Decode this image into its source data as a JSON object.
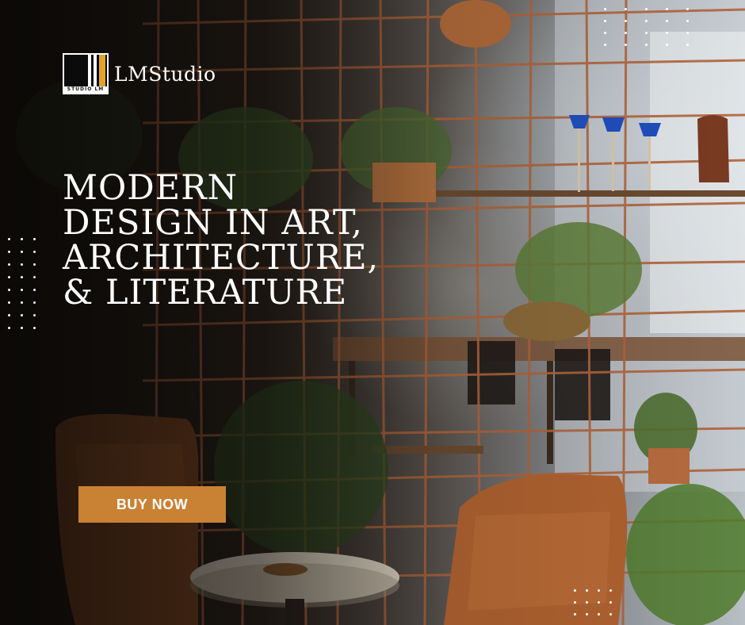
{
  "brand": {
    "name": "LMStudio",
    "mark_text": "STUDIO LM",
    "accent": "#e0a42b"
  },
  "headline": {
    "lines": [
      "MODERN",
      "DESIGN IN ART,",
      "ARCHITECTURE,",
      "& LITERATURE"
    ]
  },
  "cta": {
    "label": "BUY NOW",
    "color": "#c98133"
  },
  "background": {
    "description_icon": "cafe-interior-photo-icon"
  },
  "decor": {
    "dot_grid_icon": "dot-grid-icon"
  }
}
